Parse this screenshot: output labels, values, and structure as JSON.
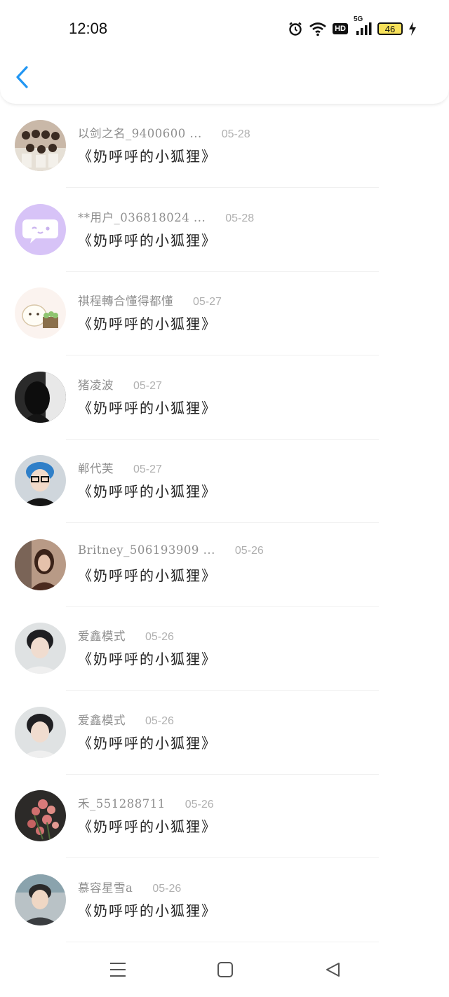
{
  "status_bar": {
    "time": "12:08",
    "icons": [
      "alarm-icon",
      "wifi-icon",
      "hd-icon",
      "5g-signal-icon",
      "battery-icon",
      "charging-icon"
    ],
    "hd_label": "HD",
    "network_label": "5G",
    "battery_level": "46"
  },
  "header": {
    "back_icon": "chevron-left-icon",
    "accent_color": "#2196f3"
  },
  "items": [
    {
      "name": "以剑之名_9400600 ...",
      "date": "05-28",
      "title": "《奶呼呼的小狐狸》"
    },
    {
      "name": "**用户_036818024 ...",
      "date": "05-28",
      "title": "《奶呼呼的小狐狸》"
    },
    {
      "name": "祺程轉合懂得都懂",
      "date": "05-27",
      "title": "《奶呼呼的小狐狸》"
    },
    {
      "name": "猪凌波",
      "date": "05-27",
      "title": "《奶呼呼的小狐狸》"
    },
    {
      "name": "郸代芙",
      "date": "05-27",
      "title": "《奶呼呼的小狐狸》"
    },
    {
      "name": "Britney_506193909 ...",
      "date": "05-26",
      "title": "《奶呼呼的小狐狸》"
    },
    {
      "name": "爱鑫模式",
      "date": "05-26",
      "title": "《奶呼呼的小狐狸》"
    },
    {
      "name": "爱鑫模式",
      "date": "05-26",
      "title": "《奶呼呼的小狐狸》"
    },
    {
      "name": "禾_551288711",
      "date": "05-26",
      "title": "《奶呼呼的小狐狸》"
    },
    {
      "name": "慕容星雪a",
      "date": "05-26",
      "title": "《奶呼呼的小狐狸》"
    }
  ],
  "nav": {
    "icons": [
      "menu-icon",
      "home-square-icon",
      "back-triangle-icon"
    ]
  }
}
